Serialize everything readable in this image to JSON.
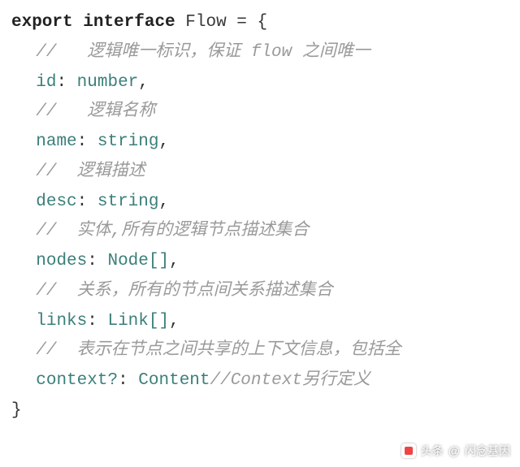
{
  "code": {
    "line1": {
      "kw_export": "export",
      "kw_interface": "interface",
      "type_name": "Flow",
      "eq": "=",
      "open": "{"
    },
    "line2": {
      "comment": "//   逻辑唯一标识，保证 flow 之间唯一"
    },
    "line3": {
      "prop": "id",
      "colon": ":",
      "type": "number",
      "comma": ","
    },
    "line4": {
      "comment": "//   逻辑名称"
    },
    "line5": {
      "prop": "name",
      "colon": ":",
      "type": "string",
      "comma": ","
    },
    "line6": {
      "comment": "//  逻辑描述"
    },
    "line7": {
      "prop": "desc",
      "colon": ":",
      "type": "string",
      "comma": ","
    },
    "line8": {
      "comment": "//  实体,所有的逻辑节点描述集合"
    },
    "line9": {
      "prop": "nodes",
      "colon": ":",
      "type": "Node[]",
      "comma": ","
    },
    "line10": {
      "comment": "//  关系，所有的节点间关系描述集合"
    },
    "line11": {
      "prop": "links",
      "colon": ":",
      "type": "Link[]",
      "comma": ","
    },
    "line12": {
      "comment": "//  表示在节点之间共享的上下文信息，包括全"
    },
    "line13": {
      "prop": "context?",
      "colon": ":",
      "type": "Content",
      "trail_comment": "//Context另行定义"
    },
    "line14": {
      "close": "}"
    }
  },
  "footer": {
    "prefix": "头条",
    "at": "@",
    "author": "闪念基因"
  }
}
